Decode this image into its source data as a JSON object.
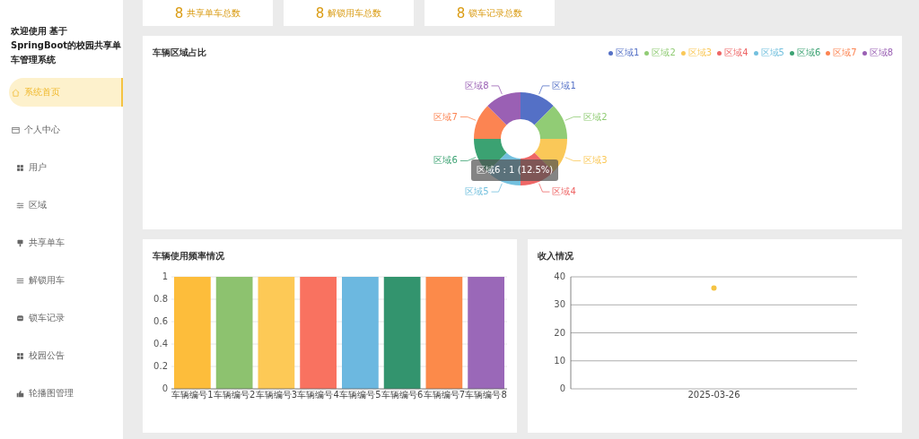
{
  "sidebar": {
    "title": "欢迎使用 基于SpringBoot的校园共享单车管理系统",
    "items": [
      {
        "label": "系统首页",
        "selected": true
      },
      {
        "label": "个人中心",
        "selected": false
      },
      {
        "label": "用户",
        "selected": false
      },
      {
        "label": "区域",
        "selected": false
      },
      {
        "label": "共享单车",
        "selected": false
      },
      {
        "label": "解锁用车",
        "selected": false
      },
      {
        "label": "锁车记录",
        "selected": false
      },
      {
        "label": "校园公告",
        "selected": false
      },
      {
        "label": "轮播图管理",
        "selected": false
      }
    ]
  },
  "stats": [
    {
      "value": "8",
      "label": "共享单车总数"
    },
    {
      "value": "8",
      "label": "解锁用车总数"
    },
    {
      "value": "8",
      "label": "锁车记录总数"
    }
  ],
  "region_chart": {
    "title": "车辆区域占比",
    "legend": [
      {
        "label": "区域1",
        "color": "#5470c6"
      },
      {
        "label": "区域2",
        "color": "#91cc75"
      },
      {
        "label": "区域3",
        "color": "#fac858"
      },
      {
        "label": "区域4",
        "color": "#ee6666"
      },
      {
        "label": "区域5",
        "color": "#73c0de"
      },
      {
        "label": "区域6",
        "color": "#3ba272"
      },
      {
        "label": "区域7",
        "color": "#fc8452"
      },
      {
        "label": "区域8",
        "color": "#9a60b4"
      }
    ],
    "chart_data": {
      "type": "donut",
      "categories": [
        "区域1",
        "区域2",
        "区域3",
        "区域4",
        "区域5",
        "区域6",
        "区域7",
        "区域8"
      ],
      "values": [
        1,
        1,
        1,
        1,
        1,
        1,
        1,
        1
      ]
    },
    "tooltip": "区域6 : 1 (12.5%)"
  },
  "usage_chart": {
    "title": "车辆使用频率情况",
    "chart_data": {
      "type": "bar",
      "categories": [
        "车辆编号1",
        "车辆编号2",
        "车辆编号3",
        "车辆编号4",
        "车辆编号5",
        "车辆编号6",
        "车辆编号7",
        "车辆编号8"
      ],
      "series": [
        {
          "values": [
            1,
            1,
            1,
            1,
            1,
            1,
            1,
            1
          ]
        }
      ],
      "ylim": [
        0,
        1
      ],
      "yticks": [
        0,
        0.2,
        0.4,
        0.6,
        0.8,
        1
      ],
      "grid": true
    }
  },
  "income_chart": {
    "title": "收入情况",
    "chart_data": {
      "type": "line",
      "categories": [
        "2025-03-26"
      ],
      "series": [
        {
          "color": "#f5c342",
          "values": [
            36
          ],
          "marker": true
        }
      ],
      "ylim": [
        0,
        40
      ],
      "yticks": [
        0,
        10,
        20,
        30,
        40
      ],
      "grid": true
    }
  }
}
